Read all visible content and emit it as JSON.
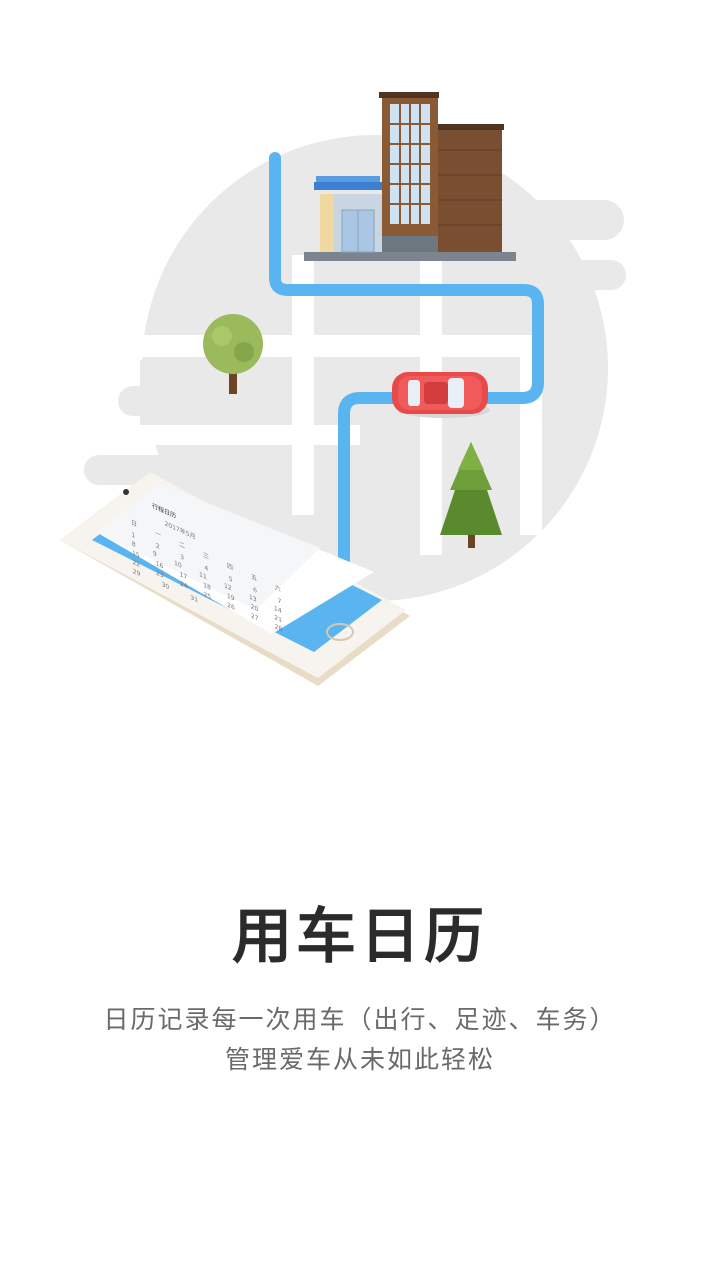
{
  "onboarding": {
    "title": "用车日历",
    "subtitle_line1": "日历记录每一次用车（出行、足迹、车务）",
    "subtitle_line2": "管理爱车从未如此轻松"
  },
  "phone_screen": {
    "app_title": "行程日历",
    "month_label": "2017年5月",
    "weekdays": [
      "日",
      "一",
      "二",
      "三",
      "四",
      "五",
      "六"
    ],
    "days": [
      [
        "1",
        "2",
        "3",
        "4",
        "5",
        "6",
        "7"
      ],
      [
        "8",
        "9",
        "10",
        "11",
        "12",
        "13",
        "14"
      ],
      [
        "15",
        "16",
        "17",
        "18",
        "19",
        "20",
        "21"
      ],
      [
        "22",
        "23",
        "24",
        "25",
        "26",
        "27",
        "28"
      ],
      [
        "29",
        "30",
        "31",
        "",
        "",
        "",
        ""
      ]
    ]
  },
  "colors": {
    "route": "#5ab4f0",
    "car": "#e84a4a",
    "circle": "#e9e9e9",
    "title": "#2b2b2b",
    "subtitle": "#6a6a6a"
  }
}
